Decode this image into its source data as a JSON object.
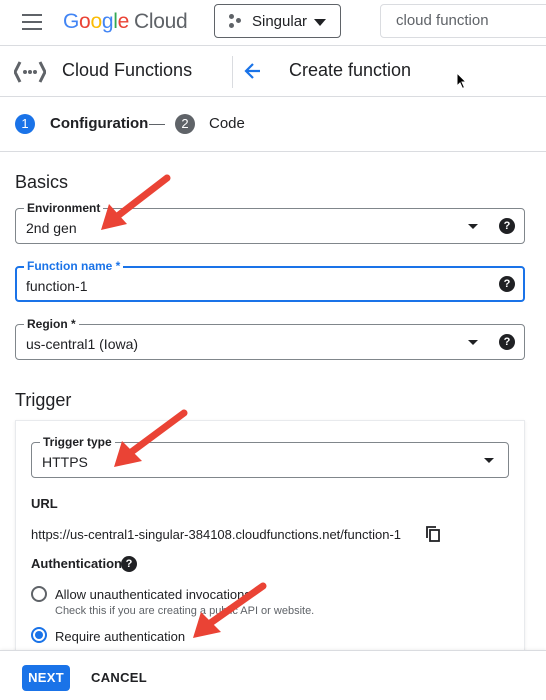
{
  "topbar": {
    "menu_icon": "hamburger-menu-icon",
    "logo_brand_letters": [
      "G",
      "o",
      "o",
      "g",
      "l",
      "e"
    ],
    "logo_product": "Cloud",
    "project_name": "Singular",
    "project_icon": "project-dots-icon",
    "search_value": "cloud function"
  },
  "header": {
    "product_icon": "cloud-functions-icon",
    "product_title": "Cloud Functions",
    "back_icon": "arrow-back-icon",
    "page_title": "Create function"
  },
  "stepper": {
    "steps": [
      {
        "number": "1",
        "label": "Configuration",
        "active": true
      },
      {
        "number": "2",
        "label": "Code",
        "active": false
      }
    ]
  },
  "basics": {
    "title": "Basics",
    "environment": {
      "label": "Environment",
      "value": "2nd gen"
    },
    "function_name": {
      "label": "Function name *",
      "value": "function-1"
    },
    "region": {
      "label": "Region *",
      "value": "us-central1 (Iowa)"
    }
  },
  "trigger": {
    "title": "Trigger",
    "trigger_type": {
      "label": "Trigger type",
      "value": "HTTPS"
    },
    "url_title": "URL",
    "url_value": "https://us-central1-singular-384108.cloudfunctions.net/function-1",
    "authentication_title": "Authentication",
    "auth_options": [
      {
        "label": "Allow unauthenticated invocations",
        "help": "Check this if you are creating a public API or website.",
        "selected": false
      },
      {
        "label": "Require authentication",
        "selected": true
      }
    ]
  },
  "actions": {
    "next_label": "NEXT",
    "cancel_label": "CANCEL"
  },
  "colors": {
    "primary": "#1a73e8",
    "annotation_arrow": "#ea4335",
    "text": "#202124",
    "secondary_text": "#5f6368"
  }
}
